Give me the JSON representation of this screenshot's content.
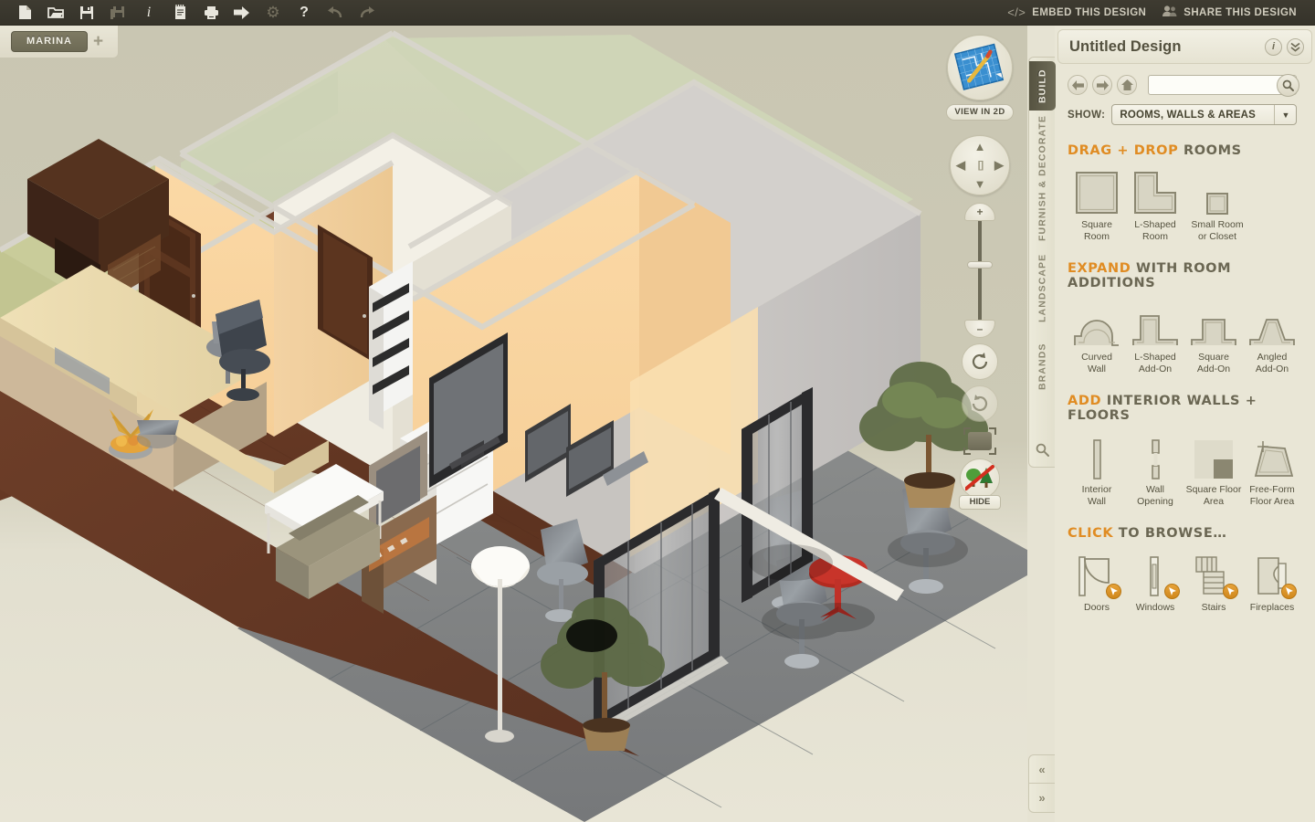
{
  "toolbar": {
    "buttons": [
      {
        "name": "new-document",
        "glyph": "□",
        "dim": false
      },
      {
        "name": "open-folder",
        "glyph": "▱",
        "dim": false
      },
      {
        "name": "save-disk",
        "glyph": "▣",
        "dim": false
      },
      {
        "name": "save-as-copy",
        "glyph": "▤",
        "dim": true
      },
      {
        "name": "info",
        "glyph": "i",
        "dim": false
      },
      {
        "name": "notepad",
        "glyph": "▥",
        "dim": false
      },
      {
        "name": "print",
        "glyph": "▧",
        "dim": false
      },
      {
        "name": "export-arrow",
        "glyph": "➡",
        "dim": false
      },
      {
        "name": "settings-gear",
        "glyph": "⚙",
        "dim": true
      },
      {
        "name": "help",
        "glyph": "?",
        "dim": false
      },
      {
        "name": "undo",
        "glyph": "↶",
        "dim": true
      },
      {
        "name": "redo",
        "glyph": "↷",
        "dim": true
      }
    ],
    "embed_label": "EMBED THIS DESIGN",
    "embed_glyph": "</>",
    "share_label": "SHARE THIS DESIGN",
    "share_glyph": "♟"
  },
  "tabbar": {
    "project_tab": "MARINA",
    "add_tab": "+"
  },
  "nav3d": {
    "view2d_label": "VIEW IN 2D",
    "pad": {
      "up": "▲",
      "down": "▼",
      "left": "◀",
      "right": "▶",
      "center": "[ ]"
    },
    "zoom_in": "+",
    "zoom_out": "–",
    "rotate_ccw": "↺",
    "rotate_cw": "↻",
    "hide_label": "HIDE"
  },
  "vtabs": {
    "items": [
      {
        "label": "BUILD",
        "active": true
      },
      {
        "label": "FURNISH & DECORATE",
        "active": false
      },
      {
        "label": "LANDSCAPE",
        "active": false
      },
      {
        "label": "BRANDS",
        "active": false
      }
    ],
    "search_glyph": "⌕"
  },
  "panel": {
    "title": "Untitled Design",
    "info_glyph": "i",
    "collapse_glyph": "»",
    "nav": {
      "back": "←",
      "forward": "→",
      "home": "⌂"
    },
    "search": {
      "value": "",
      "placeholder": "",
      "go_glyph": "⌕"
    },
    "show": {
      "label": "SHOW:",
      "value": "ROOMS, WALLS & AREAS",
      "arrow": "▼"
    },
    "sections": [
      {
        "id": "drag-drop-rooms",
        "accent": "DRAG + DROP",
        "rest": " ROOMS",
        "items": [
          {
            "name": "square-room",
            "caption": "Square\nRoom",
            "icon": "square-room-icon"
          },
          {
            "name": "l-shaped-room",
            "caption": "L-Shaped\nRoom",
            "icon": "l-shaped-room-icon"
          },
          {
            "name": "small-room-or-closet",
            "caption": "Small Room\nor Closet",
            "icon": "small-room-icon"
          }
        ]
      },
      {
        "id": "room-additions",
        "accent": "EXPAND",
        "rest": " WITH ROOM ADDITIONS",
        "items": [
          {
            "name": "curved-wall",
            "caption": "Curved\nWall",
            "icon": "curved-wall-icon"
          },
          {
            "name": "l-shaped-add-on",
            "caption": "L-Shaped\nAdd-On",
            "icon": "l-shaped-addon-icon"
          },
          {
            "name": "square-add-on",
            "caption": "Square\nAdd-On",
            "icon": "square-addon-icon"
          },
          {
            "name": "angled-add-on",
            "caption": "Angled\nAdd-On",
            "icon": "angled-addon-icon"
          }
        ]
      },
      {
        "id": "interior-walls-floors",
        "accent": "ADD",
        "rest": " INTERIOR WALLS + FLOORS",
        "items": [
          {
            "name": "interior-wall",
            "caption": "Interior\nWall",
            "icon": "interior-wall-icon"
          },
          {
            "name": "wall-opening",
            "caption": "Wall\nOpening",
            "icon": "wall-opening-icon"
          },
          {
            "name": "square-floor-area",
            "caption": "Square Floor\nArea",
            "icon": "square-floor-icon"
          },
          {
            "name": "free-form-floor-area",
            "caption": "Free-Form\nFloor Area",
            "icon": "free-form-floor-icon"
          }
        ]
      },
      {
        "id": "click-to-browse",
        "accent": "CLICK",
        "rest": " TO BROWSE…",
        "items": [
          {
            "name": "doors",
            "caption": "Doors",
            "icon": "door-icon",
            "badge": "↖"
          },
          {
            "name": "windows",
            "caption": "Windows",
            "icon": "window-icon",
            "badge": "↖"
          },
          {
            "name": "stairs",
            "caption": "Stairs",
            "icon": "stairs-icon",
            "badge": "↖"
          },
          {
            "name": "fireplaces",
            "caption": "Fireplaces",
            "icon": "fireplace-icon",
            "badge": "↖"
          }
        ]
      }
    ]
  },
  "collapse": {
    "left": "«",
    "right": "»"
  },
  "colors": {
    "toolbar_bg": "#3a3830",
    "panel_bg": "#e9e6d6",
    "accent_orange": "#e08c23",
    "text_dark": "#55523f",
    "active_tab": "#5f5c49"
  }
}
